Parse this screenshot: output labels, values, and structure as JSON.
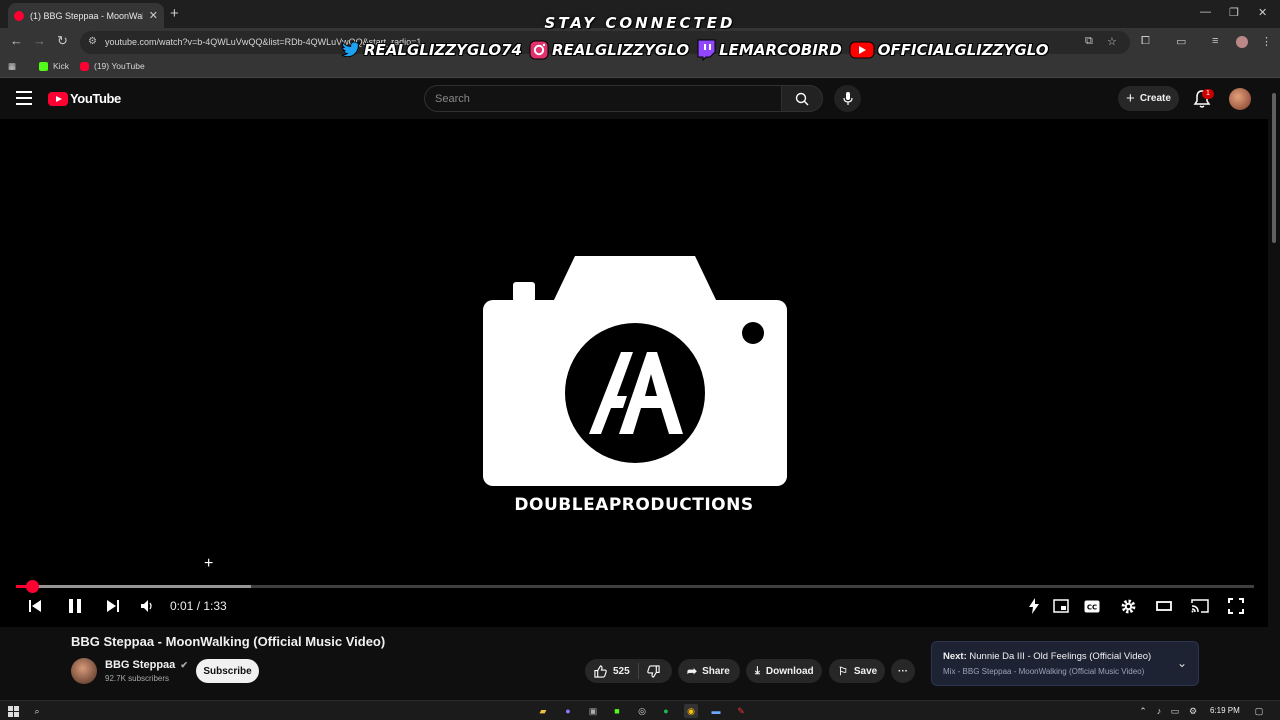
{
  "browser": {
    "tab_title": "(1) BBG Steppaa - MoonWalking",
    "url": "youtube.com/watch?v=b-4QWLuVwQQ&list=RDb-4QWLuVwQQ&start_radio=1",
    "bookmarks": [
      {
        "label": "Kick",
        "color": "#53fc18"
      },
      {
        "label": "(19) YouTube",
        "color": "#ff0033"
      }
    ]
  },
  "overlay": {
    "header": "STAY CONNECTED",
    "socials": [
      {
        "platform": "twitter",
        "handle": "REALGLIZZYGLO74",
        "icon": "twitter-bird-icon",
        "color": "#1da1f2"
      },
      {
        "platform": "instagram",
        "handle": "REALGLIZZYGLO",
        "icon": "instagram-icon",
        "color": "#e1306c"
      },
      {
        "platform": "twitch",
        "handle": "LEMARCOBIRD",
        "icon": "twitch-icon",
        "color": "#9146ff"
      },
      {
        "platform": "youtube",
        "handle": "OFFICIALGLIZZYGLO",
        "icon": "youtube-play-icon",
        "color": "#ff0000"
      }
    ]
  },
  "masthead": {
    "logo_text": "YouTube",
    "search_placeholder": "Search",
    "create_label": "Create",
    "notification_count": "1"
  },
  "player": {
    "brand_text": "DOUBLEAPRODUCTIONS",
    "time_current": "0:01",
    "time_total": "1:33",
    "time_display": "0:01 / 1:33",
    "progress_played": 0.013,
    "progress_buffered": 0.19,
    "state": "playing"
  },
  "video": {
    "title": "BBG Steppaa - MoonWalking (Official Music Video)",
    "channel_name": "BBG Steppaa",
    "subscribers": "92.7K subscribers",
    "subscribe_label": "Subscribe",
    "like_count": "525",
    "share_label": "Share",
    "download_label": "Download",
    "save_label": "Save"
  },
  "next_up": {
    "prefix": "Next:",
    "title": "Nunnie Da III - Old Feelings (Official Video)",
    "subtitle": "Mix - BBG Steppaa - MoonWalking (Official Music Video)"
  },
  "taskbar": {
    "time": "6:19 PM"
  },
  "colors": {
    "accent_red": "#ff0033",
    "bg": "#0f0f0f"
  }
}
